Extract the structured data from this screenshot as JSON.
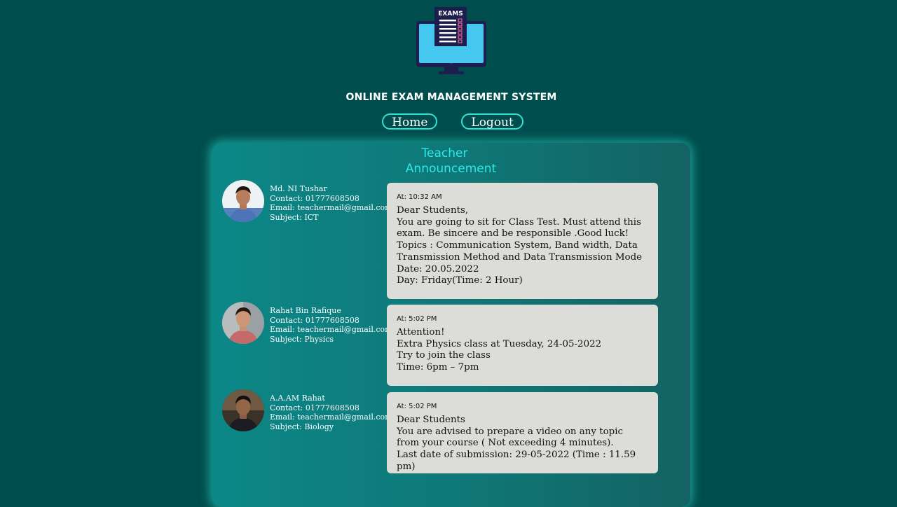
{
  "logo": {
    "label": "EXAMS",
    "icon": "exam-monitor-icon"
  },
  "site": {
    "title": "ONLINE EXAM MANAGEMENT SYSTEM"
  },
  "nav": {
    "home_label": "Home",
    "logout_label": "Logout"
  },
  "panel": {
    "title_line1": "Teacher",
    "title_line2": "Announcement"
  },
  "announcements": [
    {
      "teacher": {
        "name": "Md. NI Tushar",
        "contact": "Contact: 01777608508",
        "email": "Email: teachermail@gmail.com",
        "subject": "Subject: ICT"
      },
      "time": "At: 10:32 AM",
      "message": "Dear Students,\nYou are going to sit for Class Test. Must attend this exam. Be sincere and be responsible .Good luck!\nTopics : Communication System, Band width, Data Transmission Method and Data Transmission Mode\nDate: 20.05.2022\nDay: Friday(Time: 2 Hour)"
    },
    {
      "teacher": {
        "name": "Rahat Bin Rafique",
        "contact": "Contact: 01777608508",
        "email": "Email: teachermail@gmail.com",
        "subject": "Subject: Physics"
      },
      "time": "At: 5:02 PM",
      "message": "Attention!\nExtra Physics class at Tuesday, 24-05-2022\nTry to join the class\nTime: 6pm – 7pm"
    },
    {
      "teacher": {
        "name": "A.A.AM Rahat",
        "contact": "Contact: 01777608508",
        "email": "Email: teachermail@gmail.com",
        "subject": "Subject: Biology"
      },
      "time": "At: 5:02 PM",
      "message": "Dear Students\nYou are advised to prepare a video on any topic from your course ( Not exceeding 4 minutes).\nLast date of submission: 29-05-2022 (Time : 11.59 pm)"
    }
  ],
  "colors": {
    "background": "#004d4d",
    "accent": "#2fe3d2",
    "title_cyan": "#2fe8e8",
    "message_bg": "#dcdcd9"
  }
}
